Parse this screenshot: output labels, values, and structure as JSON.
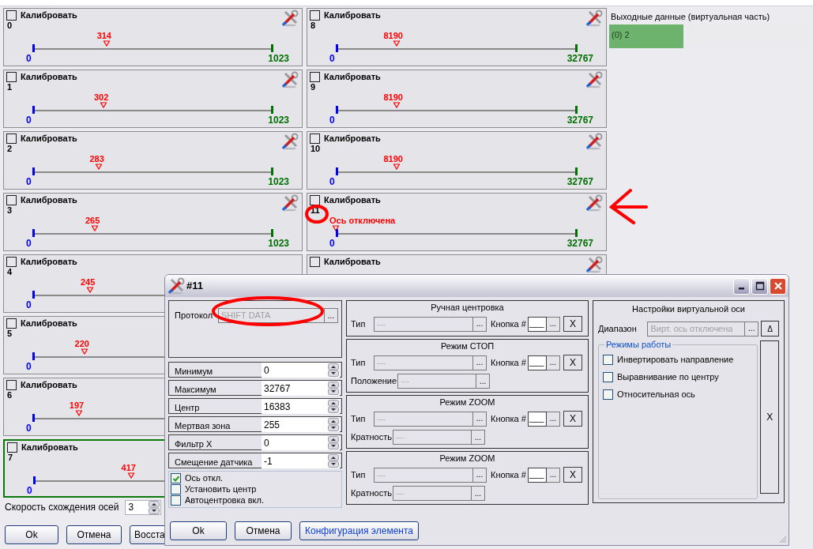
{
  "axes": [
    {
      "number": "0",
      "calibrate_label": "Калибровать",
      "calibrate_checked": false,
      "value": "314",
      "level": 0.307,
      "min": "0",
      "max": "1023",
      "selected": false
    },
    {
      "number": "1",
      "calibrate_label": "Калибровать",
      "calibrate_checked": false,
      "value": "302",
      "level": 0.295,
      "min": "0",
      "max": "1023",
      "selected": false
    },
    {
      "number": "2",
      "calibrate_label": "Калибровать",
      "calibrate_checked": false,
      "value": "283",
      "level": 0.277,
      "min": "0",
      "max": "1023",
      "selected": false
    },
    {
      "number": "3",
      "calibrate_label": "Калибровать",
      "calibrate_checked": false,
      "value": "265",
      "level": 0.259,
      "min": "0",
      "max": "1023",
      "selected": false
    },
    {
      "number": "4",
      "calibrate_label": "Калибровать",
      "calibrate_checked": false,
      "value": "245",
      "level": 0.239,
      "min": "0",
      "selected": false
    },
    {
      "number": "5",
      "calibrate_label": "Калибровать",
      "calibrate_checked": false,
      "value": "220",
      "level": 0.215,
      "min": "0",
      "selected": false
    },
    {
      "number": "6",
      "calibrate_label": "Калибровать",
      "calibrate_checked": false,
      "value": "197",
      "level": 0.193,
      "min": "0",
      "selected": false
    },
    {
      "number": "7",
      "calibrate_label": "Калибровать",
      "calibrate_checked": false,
      "value": "417",
      "level": 0.408,
      "min": "0",
      "selected": true
    },
    {
      "number": "8",
      "calibrate_label": "Калибровать",
      "calibrate_checked": false,
      "value": "8190",
      "level": 0.25,
      "min": "0",
      "max": "32767",
      "selected": false
    },
    {
      "number": "9",
      "calibrate_label": "Калибровать",
      "calibrate_checked": false,
      "value": "8190",
      "level": 0.25,
      "min": "0",
      "max": "32767",
      "selected": false
    },
    {
      "number": "10",
      "calibrate_label": "Калибровать",
      "calibrate_checked": false,
      "value": "8190",
      "level": 0.25,
      "min": "0",
      "max": "32767",
      "selected": false
    },
    {
      "number": "11",
      "calibrate_label": "Калибровать",
      "calibrate_checked": false,
      "value": "Ось отключена",
      "level": 0,
      "min": "0",
      "max": "32767",
      "selected": false
    },
    {
      "calibrate_label": "Калибровать",
      "calibrate_checked": false,
      "selected": false
    }
  ],
  "outputs": {
    "title": "Выходные данные (виртуальная часть)",
    "items": [
      {
        "label": "(0) 2",
        "active": true
      }
    ]
  },
  "speed": {
    "label": "Скорость схождения осей",
    "value": "3"
  },
  "buttons": [
    "Ok",
    "Отмена",
    "Восста"
  ],
  "dialog": {
    "title": "#11",
    "protocol": {
      "label": "Протокол",
      "value": "SHIFT DATA",
      "browse": "...",
      "disabled": true
    },
    "params": [
      {
        "label": "Минимум",
        "value": "0"
      },
      {
        "label": "Максимум",
        "value": "32767"
      },
      {
        "label": "Центр",
        "value": "16383"
      },
      {
        "label": "Мертвая зона",
        "value": "255"
      },
      {
        "label": "Фильтр X",
        "value": "0"
      },
      {
        "label": "Смещение датчика",
        "value": "-1"
      }
    ],
    "options": [
      {
        "label": "Ось откл.",
        "checked": true
      },
      {
        "label": "Установить центр",
        "checked": false
      },
      {
        "label": "Автоцентровка вкл.",
        "checked": false
      }
    ],
    "groups": [
      {
        "title": "Ручная центровка",
        "type": {
          "label": "Тип",
          "placeholder": "---",
          "browse": "..."
        },
        "key": {
          "label": "Кнопка #",
          "value": "___",
          "browse": "..."
        },
        "clear": "X"
      },
      {
        "title": "Режим СТОП",
        "type": {
          "label": "Тип",
          "placeholder": "---",
          "browse": "..."
        },
        "key": {
          "label": "Кнопка #",
          "value": "___",
          "browse": "..."
        },
        "clear": "X",
        "extra": {
          "label": "Положение",
          "placeholder": "---",
          "browse": "..."
        }
      },
      {
        "title": "Режим ZOOM",
        "type": {
          "label": "Тип",
          "placeholder": "---",
          "browse": "..."
        },
        "key": {
          "label": "Кнопка #",
          "value": "___",
          "browse": "..."
        },
        "clear": "X",
        "extra": {
          "label": "Кратность",
          "placeholder": "---",
          "browse": "..."
        }
      },
      {
        "title": "Режим ZOOM",
        "type": {
          "label": "Тип",
          "placeholder": "---",
          "browse": "..."
        },
        "key": {
          "label": "Кнопка #",
          "value": "___",
          "browse": "..."
        },
        "clear": "X",
        "extra": {
          "label": "Кратность",
          "placeholder": "---",
          "browse": "..."
        }
      }
    ],
    "virtual": {
      "title": "Настройки виртуальной оси",
      "range": {
        "label": "Диапазон",
        "value": "Вирт. ось отключена",
        "browse": "...",
        "disabled": true
      },
      "delta": "Δ",
      "modes_title": "Режимы работы",
      "modes": [
        {
          "label": "Инвертировать направление",
          "checked": false
        },
        {
          "label": "Выравнивание по центру",
          "checked": false
        },
        {
          "label": "Относительная ось",
          "checked": false
        }
      ],
      "clear": "X"
    },
    "buttons": [
      {
        "label": "Ok",
        "kind": "plain"
      },
      {
        "label": "Отмена",
        "kind": "plain"
      },
      {
        "label": "Конфигурация элемента",
        "kind": "link"
      }
    ]
  }
}
